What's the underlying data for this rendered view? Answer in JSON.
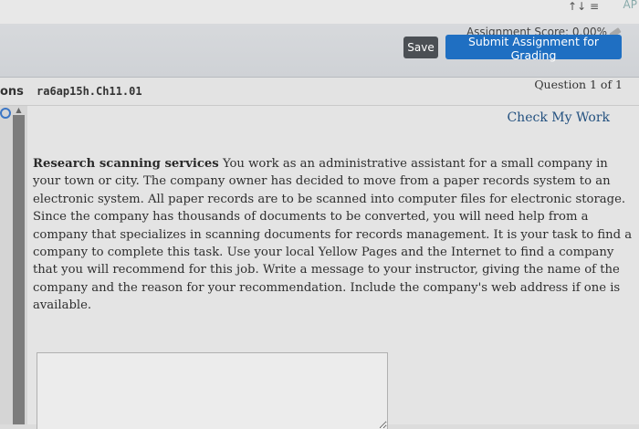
{
  "top": {
    "icons": "↑↓ ≡",
    "right_text": "AP"
  },
  "toolbar": {
    "score": "Assignment Score: 0.00%",
    "save_label": "Save",
    "submit_label": "Submit Assignment for Grading"
  },
  "question_header": {
    "left_tab": "ons",
    "id": "ra6ap15h.Ch11.01",
    "count": "Question 1 of 1"
  },
  "sidebar": {
    "scroll_up": "▲"
  },
  "main": {
    "check_label": "Check My Work",
    "question_title": "Research scanning services",
    "question_body": "You work as an administrative assistant for a small company in your town or city. The company owner has decided to move from a paper records system to an electronic system. All paper records are to be scanned into computer files for electronic storage. Since the company has thousands of documents to be converted, you will need help from a company that specializes in scanning documents for records management. It is your task to find a company to complete this task. Use your local Yellow Pages and the Internet to find a company that you will recommend for this job. Write a message to your instructor, giving the name of the company and the reason for your recommendation. Include the company's web address if one is available.",
    "answer_value": ""
  },
  "colors": {
    "accent": "#1f6fc2",
    "save_button": "#4b4f54",
    "link": "#22507f"
  }
}
